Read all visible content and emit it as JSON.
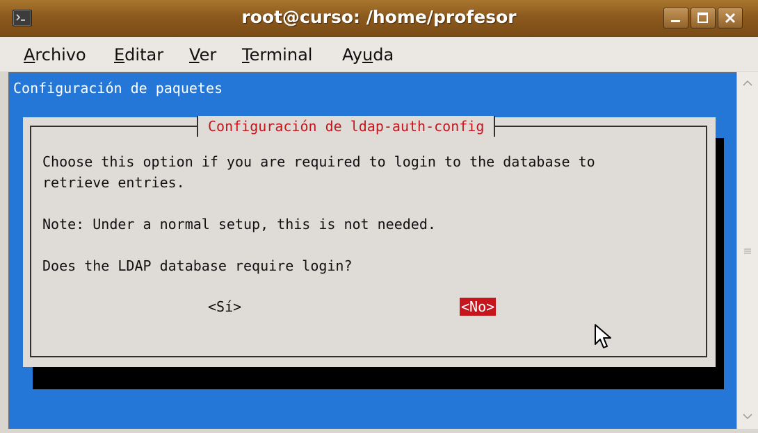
{
  "window": {
    "title": "root@curso: /home/profesor",
    "controls": [
      "minimize-icon",
      "maximize-icon",
      "close-icon"
    ]
  },
  "menu": [
    {
      "label": "Archivo",
      "mnemonic": "A"
    },
    {
      "label": "Editar",
      "mnemonic": "E"
    },
    {
      "label": "Ver",
      "mnemonic": "V"
    },
    {
      "label": "Terminal",
      "mnemonic": "T"
    },
    {
      "label": "Ayuda",
      "mnemonic": "u"
    }
  ],
  "terminal": {
    "backtitle": "Configuración de paquetes",
    "dialog": {
      "title": "Configuración de ldap-auth-config",
      "line1": "Choose this option if you are required to login to the database to",
      "line2": "retrieve entries.",
      "line3": "Note: Under a normal setup, this is not needed.",
      "line4": "Does the LDAP database require login?",
      "option_yes": "<Sí>",
      "option_no": "<No>",
      "selected": "<No>"
    }
  },
  "colors": {
    "terminal_bg": "#2477d6",
    "dialog_bg": "#dfdcd8",
    "accent_red": "#c4161c",
    "titlebar": "#8c5a1e"
  }
}
